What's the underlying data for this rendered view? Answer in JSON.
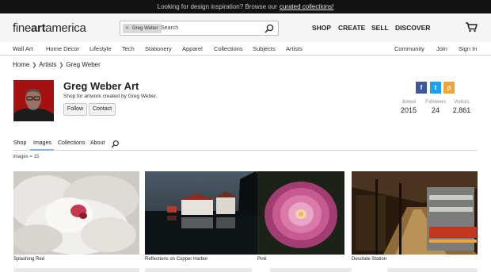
{
  "topbar": {
    "text": "Looking for design inspiration? Browse our",
    "link": "curated collections!"
  },
  "header": {
    "logo_prefix": "fine",
    "logo_bold": "art",
    "logo_suffix": "america",
    "search_chip": "Greg Weber",
    "search_placeholder": "Search",
    "nav": [
      "SHOP",
      "CREATE",
      "SELL",
      "DISCOVER"
    ],
    "cart_icon": "cart-icon"
  },
  "categories": [
    "Wall Art",
    "Home Decor",
    "Lifestyle",
    "Tech",
    "Stationery",
    "Apparel",
    "Collections",
    "Subjects",
    "Artists",
    "Community",
    "Join",
    "Sign In"
  ],
  "breadcrumb": [
    "Home",
    "Artists",
    "Greg Weber"
  ],
  "artist": {
    "name": "Greg Weber Art",
    "tagline": "Shop for artwork created by Greg Weber.",
    "follow_label": "Follow",
    "contact_label": "Contact"
  },
  "social": {
    "facebook": "f",
    "twitter": "t",
    "pinterest": "p",
    "colors": {
      "facebook": "#3b5998",
      "twitter": "#1da1f2",
      "pinterest": "#f0a43a"
    }
  },
  "stats": [
    {
      "label": "Joined",
      "value": "2015"
    },
    {
      "label": "Followers",
      "value": "24"
    },
    {
      "label": "Visitors",
      "value": "2,861"
    }
  ],
  "tabs": [
    "Shop",
    "Images",
    "Collections",
    "About"
  ],
  "active_tab": "Images",
  "images_count": "Images = 15",
  "artworks": [
    {
      "title": "Splashing Red"
    },
    {
      "title": "Reflections on Copper Harbor"
    },
    {
      "title": "Pink"
    },
    {
      "title": "Desolate Station"
    }
  ],
  "accent_color": "#7fb3e3"
}
